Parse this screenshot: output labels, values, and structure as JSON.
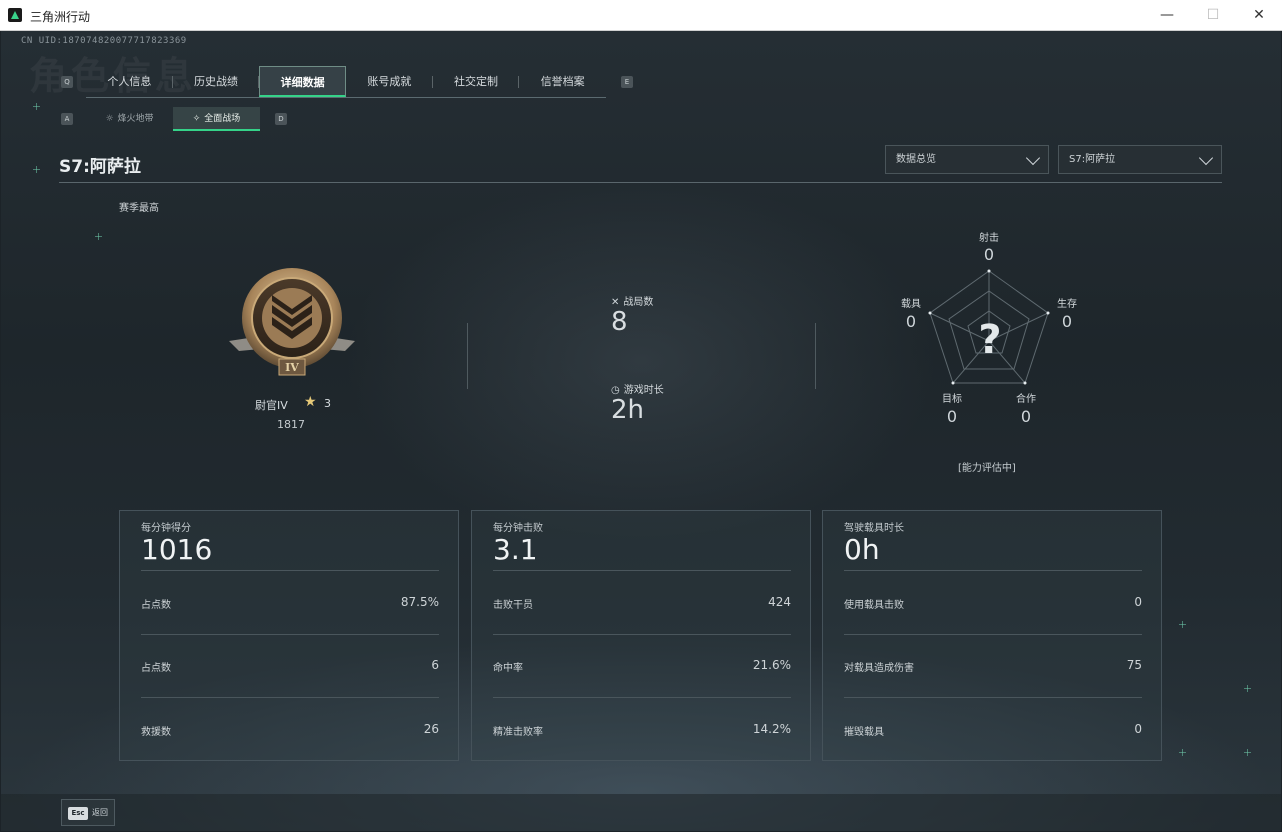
{
  "window": {
    "title": "三角洲行动",
    "minimize": "—",
    "maximize": "☐",
    "close": "✕"
  },
  "header": {
    "uid": "CN UID:187074820077717823369",
    "bg_title": "角色信息",
    "key_left": "Q",
    "key_right": "E",
    "subkey_left": "A",
    "subkey_right": "D"
  },
  "tabs": [
    {
      "label": "个人信息"
    },
    {
      "label": "历史战绩"
    },
    {
      "label": "详细数据",
      "active": true
    },
    {
      "label": "账号成就"
    },
    {
      "label": "社交定制"
    },
    {
      "label": "信誉档案"
    }
  ],
  "subtabs": [
    {
      "label": "烽火地带",
      "icon": "☼"
    },
    {
      "label": "全面战场",
      "icon": "✧",
      "active": true
    }
  ],
  "season": {
    "title": "S7:阿萨拉",
    "filter_overview": "数据总览",
    "filter_season": "S7:阿萨拉",
    "season_high": "赛季最高"
  },
  "rank": {
    "name": "尉官IV",
    "stars": "3",
    "score": "1817",
    "numeral": "IV"
  },
  "stats": {
    "matches_label": "战局数",
    "matches_value": "8",
    "playtime_label": "游戏时长",
    "playtime_value": "2h"
  },
  "radar": {
    "top_label": "射击",
    "top_value": "0",
    "right_label": "生存",
    "right_value": "0",
    "bottom_right_label": "合作",
    "bottom_right_value": "0",
    "bottom_left_label": "目标",
    "bottom_left_value": "0",
    "left_label": "载具",
    "left_value": "0",
    "center": "?",
    "status": "[能力评估中]"
  },
  "cards": [
    {
      "head": "每分钟得分",
      "big": "1016",
      "rows": [
        {
          "label": "占点数",
          "value": "87.5%"
        },
        {
          "label": "占点数",
          "value": "6"
        },
        {
          "label": "救援数",
          "value": "26"
        }
      ]
    },
    {
      "head": "每分钟击败",
      "big": "3.1",
      "rows": [
        {
          "label": "击败干员",
          "value": "424"
        },
        {
          "label": "命中率",
          "value": "21.6%"
        },
        {
          "label": "精准击败率",
          "value": "14.2%"
        }
      ]
    },
    {
      "head": "驾驶载具时长",
      "big": "0h",
      "rows": [
        {
          "label": "使用载具击败",
          "value": "0"
        },
        {
          "label": "对载具造成伤害",
          "value": "75"
        },
        {
          "label": "摧毁载具",
          "value": "0"
        }
      ]
    }
  ],
  "footer": {
    "esc_key": "Esc",
    "esc_label": "返回"
  },
  "colors": {
    "accent": "#35d389",
    "background": "#1e262b",
    "badge_gold": "#c9a978"
  }
}
